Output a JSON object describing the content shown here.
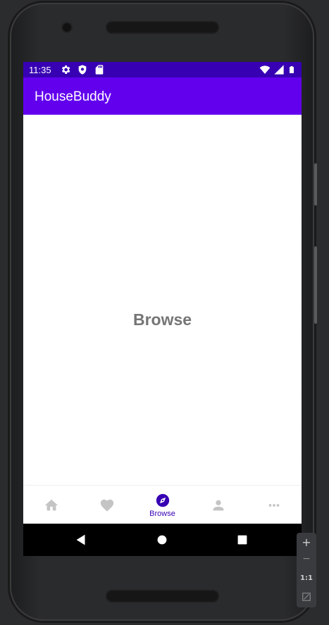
{
  "status_bar": {
    "time": "11:35",
    "left_icons": [
      "settings-icon",
      "shield-icon",
      "sd-card-icon"
    ],
    "right_icons": [
      "wifi-icon",
      "signal-icon",
      "battery-icon"
    ],
    "color": "#3700b3"
  },
  "app_bar": {
    "title": "HouseBuddy",
    "color": "#6200ee"
  },
  "content": {
    "label": "Browse"
  },
  "bottom_nav": {
    "items": [
      {
        "icon": "home-icon",
        "label": "",
        "selected": false
      },
      {
        "icon": "heart-icon",
        "label": "",
        "selected": false
      },
      {
        "icon": "compass-icon",
        "label": "Browse",
        "selected": true
      },
      {
        "icon": "person-icon",
        "label": "",
        "selected": false
      },
      {
        "icon": "more-icon",
        "label": "",
        "selected": false
      }
    ],
    "active_color": "#3700b3",
    "inactive_color": "#c4c4c4"
  },
  "system_nav": {
    "buttons": [
      "back-icon",
      "home-circle-icon",
      "recents-icon"
    ]
  },
  "emulator_toolbar": {
    "zoom_in": "+",
    "zoom_out": "−",
    "ratio": "1:1"
  }
}
